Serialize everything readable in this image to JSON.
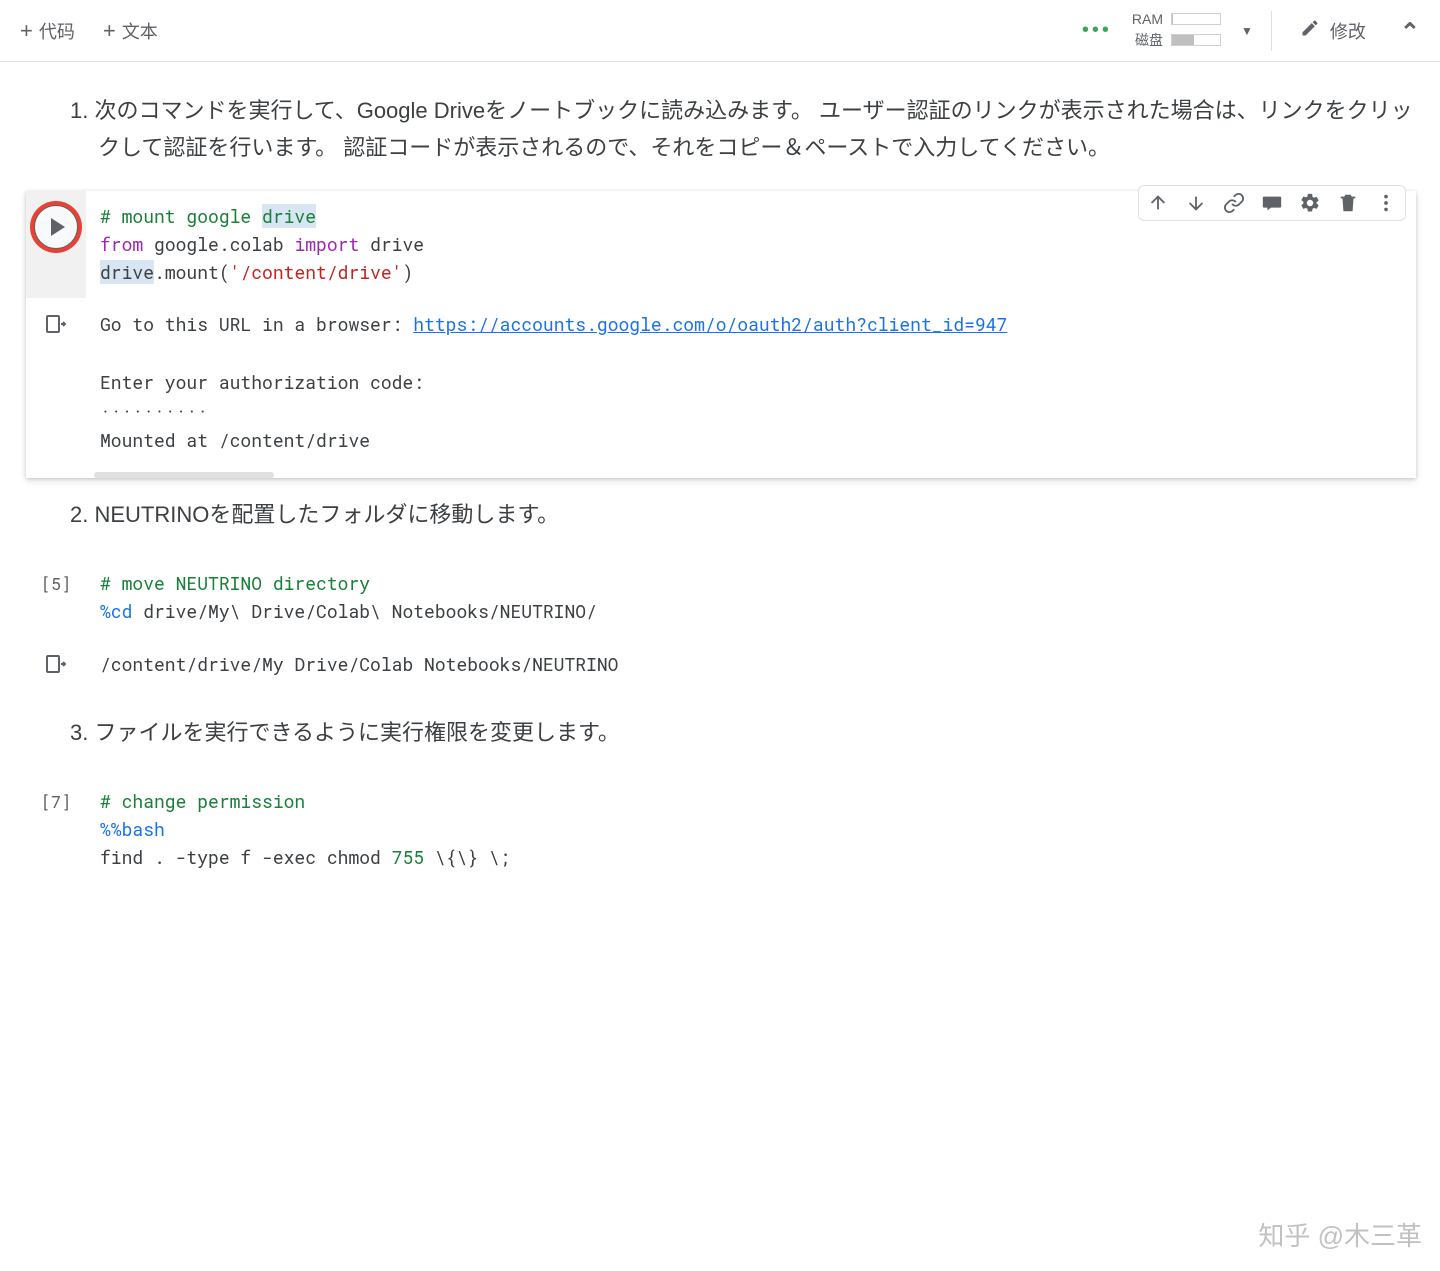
{
  "toolbar": {
    "code_label": "代码",
    "text_label": "文本",
    "ram_label": "RAM",
    "disk_label": "磁盘",
    "ram_fill_pct": 2,
    "disk_fill_pct": 45,
    "edit_label": "修改"
  },
  "steps": {
    "s1": "1. 次のコマンドを実行して、Google Driveをノートブックに読み込みます。 ユーザー認証のリンクが表示された場合は、リンクをクリックして認証を行います。 認証コードが表示されるので、それをコピー＆ペーストで入力してください。",
    "s2": "2. NEUTRINOを配置したフォルダに移動します。",
    "s3": "3. ファイルを実行できるように実行権限を変更します。"
  },
  "cells": {
    "c1": {
      "prompt_label": "",
      "code": {
        "l1_comment": "# mount google ",
        "l1_comment_hl": "drive",
        "l2_kw1": "from",
        "l2_mod": " google.colab ",
        "l2_kw2": "import",
        "l2_imp": " drive",
        "l3_pre": "drive.mount(",
        "l3_str": "'/content/drive'",
        "l3_post": ")"
      },
      "output": {
        "line1_pre": "Go to this URL in a browser: ",
        "line1_url": "https://accounts.google.com/o/oauth2/auth?client_id=947",
        "line2": "",
        "line3": "Enter your authorization code:",
        "line4": "··········",
        "line5": "Mounted at /content/drive"
      }
    },
    "c2": {
      "prompt_label": "[5]",
      "code": {
        "l1_comment": "# move NEUTRINO directory",
        "l2_magic": "%cd",
        "l2_rest": " drive/My\\ Drive/Colab\\ Notebooks/NEUTRINO/"
      },
      "output": {
        "line1": "/content/drive/My Drive/Colab Notebooks/NEUTRINO"
      }
    },
    "c3": {
      "prompt_label": "[7]",
      "code": {
        "l1_comment": "# change permission",
        "l2_magic": "%%bash",
        "l3_pre": "find . -type f -exec chmod ",
        "l3_num": "755",
        "l3_post": " \\{\\} \\;"
      }
    }
  },
  "watermark": "知乎 @木三革"
}
